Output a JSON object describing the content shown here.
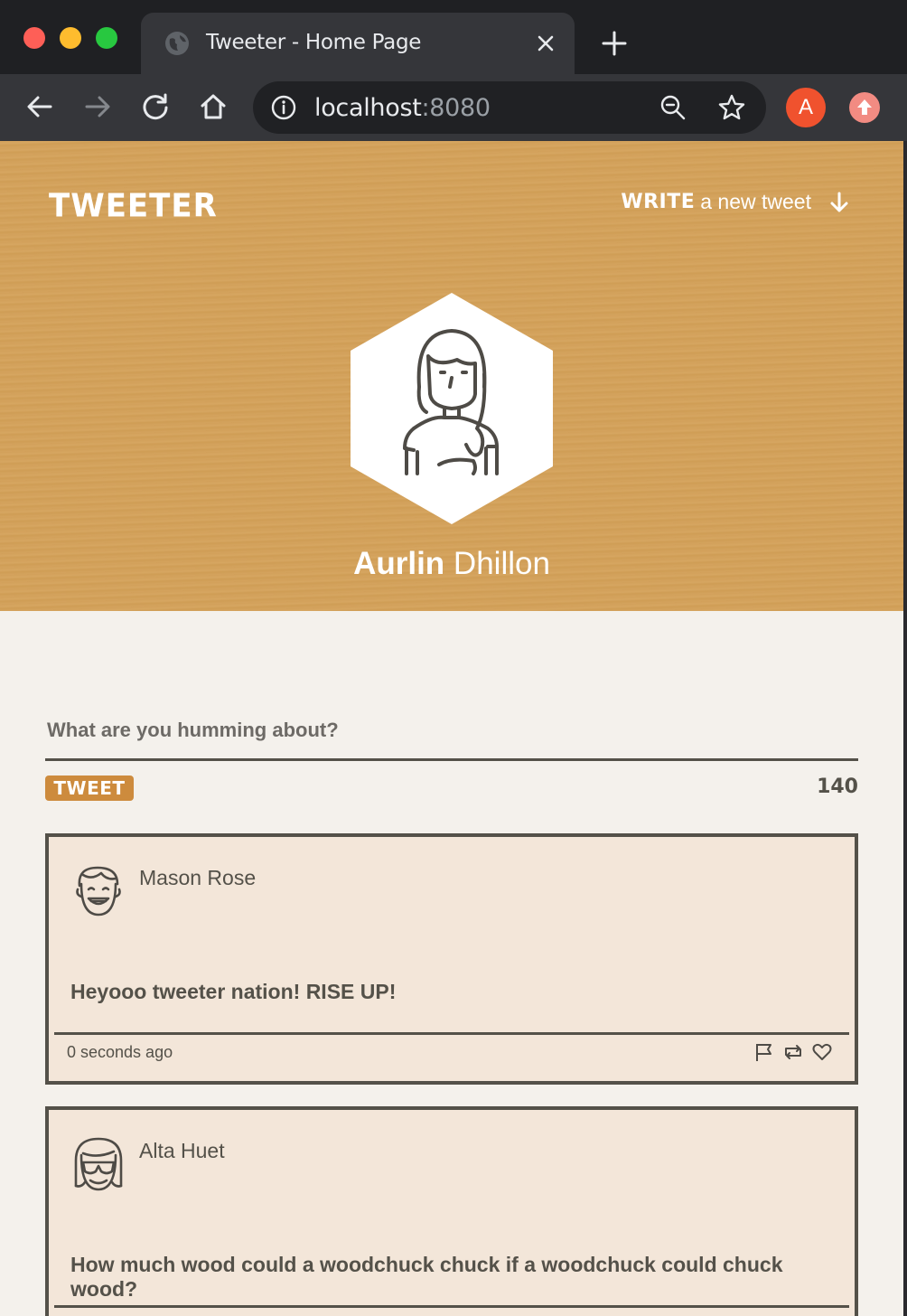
{
  "browser": {
    "tab_title": "Tweeter - Home Page",
    "url_host": "localhost",
    "url_port": ":8080",
    "profile_initial": "A"
  },
  "header": {
    "brand": "TWEETER",
    "write_strong": "WRITE",
    "write_rest": "a new tweet"
  },
  "profile": {
    "first_name": "Aurlin",
    "last_name": "Dhillon"
  },
  "compose": {
    "placeholder": "What are you humming about?",
    "button_label": "TWEET",
    "char_count": "140"
  },
  "tweets": [
    {
      "name": "Mason Rose",
      "text": "Heyooo tweeter nation! RISE UP!",
      "time": "0 seconds ago"
    },
    {
      "name": "Alta Huet",
      "text": "How much wood could a woodchuck chuck if a woodchuck could chuck wood?",
      "time": ""
    }
  ],
  "colors": {
    "hero_bg": "#d2a05a",
    "accent": "#cd8b3d",
    "ink": "#545149",
    "tweet_bg": "#f3e6d9",
    "page_bg": "#f4f1ec"
  }
}
